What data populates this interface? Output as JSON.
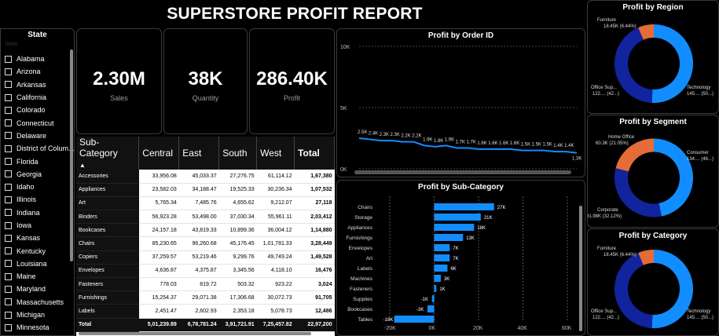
{
  "title": "SUPERSTORE PROFIT REPORT",
  "slicer": {
    "title": "State",
    "header": "State",
    "items": [
      "Alabama",
      "Arizona",
      "Arkansas",
      "California",
      "Colorado",
      "Connecticut",
      "Delaware",
      "District of Colum...",
      "Florida",
      "Georgia",
      "Idaho",
      "Illinois",
      "Indiana",
      "Iowa",
      "Kansas",
      "Kentucky",
      "Louisiana",
      "Maine",
      "Maryland",
      "Massachusetts",
      "Michigan",
      "Minnesota"
    ]
  },
  "kpis": [
    {
      "value": "2.30M",
      "label": "Sales"
    },
    {
      "value": "38K",
      "label": "Quantity"
    },
    {
      "value": "286.40K",
      "label": "Profit"
    }
  ],
  "table": {
    "headers": [
      "Sub-Category",
      "Central",
      "East",
      "South",
      "West",
      "Total"
    ],
    "rows": [
      [
        "Accessories",
        "33,956.08",
        "45,033.37",
        "27,276.75",
        "61,114.12",
        "1,67,380"
      ],
      [
        "Appliances",
        "23,582.03",
        "34,188.47",
        "19,525.33",
        "30,236.34",
        "1,07,532"
      ],
      [
        "Art",
        "5,765.34",
        "7,485.76",
        "4,655.62",
        "9,212.07",
        "27,118"
      ],
      [
        "Binders",
        "56,923.28",
        "53,498.00",
        "37,030.34",
        "55,961.11",
        "2,03,412"
      ],
      [
        "Bookcases",
        "24,157.18",
        "43,819.33",
        "10,899.36",
        "36,004.12",
        "1,14,880"
      ],
      [
        "Chairs",
        "85,230.65",
        "96,260.68",
        "45,176.45",
        "1,01,781.33",
        "3,28,449"
      ],
      [
        "Copiers",
        "37,259.57",
        "53,219.46",
        "9,299.76",
        "49,749.24",
        "1,49,528"
      ],
      [
        "Envelopes",
        "4,636.87",
        "4,375.87",
        "3,345.56",
        "4,118.10",
        "16,476"
      ],
      [
        "Fasteners",
        "778.03",
        "819.72",
        "503.32",
        "923.22",
        "3,024"
      ],
      [
        "Furnishings",
        "15,254.37",
        "29,071.38",
        "17,306.68",
        "30,072.73",
        "91,705"
      ],
      [
        "Labels",
        "2,451.47",
        "2,602.93",
        "2,353.18",
        "5,078.73",
        "12,486"
      ]
    ],
    "total": [
      "Total",
      "5,01,239.89",
      "6,78,781.24",
      "3,91,721.91",
      "7,25,457.82",
      "22,97,200"
    ]
  },
  "line_chart": {
    "title": "Profit by Order ID",
    "y_ticks": [
      "10K",
      "5K",
      "0K"
    ],
    "labels": [
      "2.5K",
      "2.4K",
      "2.3K",
      "2.3K",
      "2.2K",
      "2.2K",
      "1.9K",
      "1.8K",
      "1.9K",
      "1.7K",
      "1.7K",
      "1.6K",
      "1.6K",
      "1.6K",
      "1.6K",
      "1.5K",
      "1.5K",
      "1.5K",
      "1.4K",
      "1.4K",
      "1.3K"
    ]
  },
  "bar_chart": {
    "title": "Profit by Sub-Category",
    "x_ticks": [
      "-20K",
      "0K",
      "20K",
      "40K",
      "60K"
    ]
  },
  "donuts": [
    {
      "title": "Profit by Region",
      "lbl_top": "Furniture",
      "lbl_top2": "18.45K (6.44%)",
      "lbl_left": "Office Sup...",
      "lbl_left2": "122.... (42...)",
      "lbl_right": "Technology",
      "lbl_right2": "145.... (50...)"
    },
    {
      "title": "Profit by Segment",
      "lbl_top": "Home Office",
      "lbl_top2": "60.3K (21.05%)",
      "lbl_left": "Corporate",
      "lbl_left2": "91.98K (32.12%)",
      "lbl_right": "Consumer",
      "lbl_right2": "134.... (46...)"
    },
    {
      "title": "Profit by Category",
      "lbl_top": "Furniture",
      "lbl_top2": "18.45K (6.44%)",
      "lbl_left": "Office Sup...",
      "lbl_left2": "122.... (42...)",
      "lbl_right": "Technology",
      "lbl_right2": "145.... (50...)"
    }
  ],
  "colors": {
    "blue": "#118DFF",
    "navy": "#12239E",
    "orange": "#E66C37"
  },
  "chart_data": [
    {
      "type": "line",
      "title": "Profit by Order ID",
      "ylim": [
        0,
        10000
      ],
      "values": [
        2500,
        2400,
        2300,
        2300,
        2200,
        2200,
        1900,
        1800,
        1900,
        1700,
        1700,
        1600,
        1600,
        1600,
        1600,
        1500,
        1500,
        1500,
        1400,
        1400,
        1300
      ]
    },
    {
      "type": "bar",
      "title": "Profit by Sub-Category",
      "categories": [
        "Chairs",
        "Storage",
        "Appliances",
        "Furnishings",
        "Envelopes",
        "Art",
        "Labels",
        "Machines",
        "Fasteners",
        "Supplies",
        "Bookcases",
        "Tables"
      ],
      "values": [
        27000,
        21000,
        18000,
        13000,
        7000,
        7000,
        6000,
        3000,
        1000,
        -1000,
        -3000,
        -18000
      ],
      "labels": [
        "27K",
        "21K",
        "18K",
        "13K",
        "7K",
        "7K",
        "6K",
        "3K",
        "1K",
        "-1K",
        "-3K",
        "-18K"
      ],
      "xlim": [
        -20000,
        60000
      ]
    },
    {
      "type": "pie",
      "title": "Profit by Region",
      "categories": [
        "Technology",
        "Office Sup...",
        "Furniture"
      ],
      "values": [
        50.3,
        42.3,
        6.44
      ]
    },
    {
      "type": "pie",
      "title": "Profit by Segment",
      "categories": [
        "Consumer",
        "Corporate",
        "Home Office"
      ],
      "values": [
        46.83,
        32.12,
        21.05
      ]
    },
    {
      "type": "pie",
      "title": "Profit by Category",
      "categories": [
        "Technology",
        "Office Sup...",
        "Furniture"
      ],
      "values": [
        50.3,
        42.3,
        6.44
      ]
    }
  ]
}
